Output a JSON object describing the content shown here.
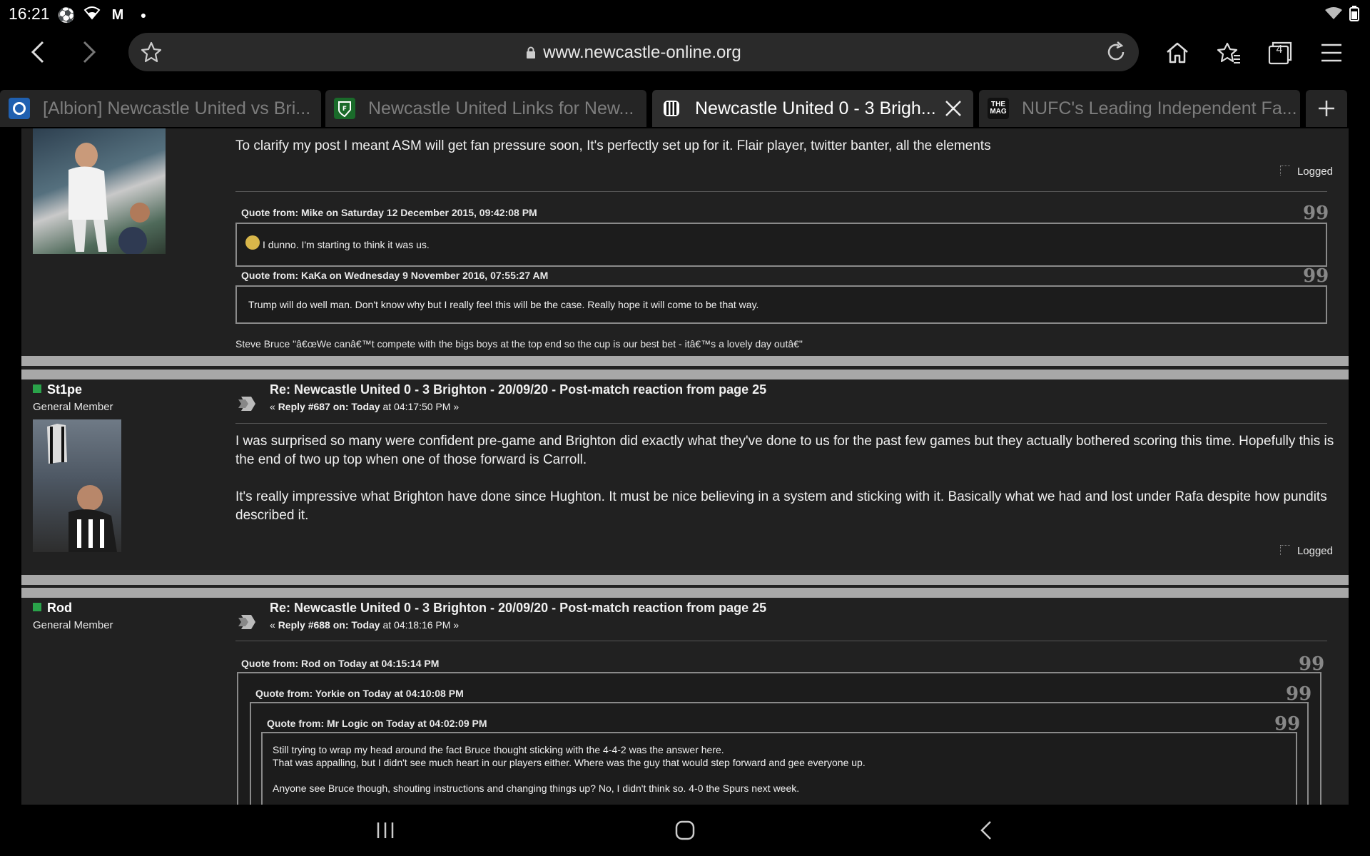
{
  "status": {
    "time": "16:21",
    "left_icons": [
      "football-icon",
      "wifi-icon",
      "gmail-icon",
      "dot-icon"
    ],
    "right_icons": [
      "wifi-signal-icon",
      "battery-icon"
    ]
  },
  "browser": {
    "url": "www.newcastle-online.org",
    "tab_count": "4",
    "tabs": [
      {
        "title": "[Albion] Newcastle United vs Bri...",
        "favicon": "brighton-icon"
      },
      {
        "title": "Newcastle United Links for New...",
        "favicon": "nufc-crest-icon"
      },
      {
        "title": "Newcastle United 0 - 3 Brigh...",
        "favicon": "stripes-icon",
        "active": true
      },
      {
        "title": "NUFC's Leading Independent Fa...",
        "favicon": "the-mag-icon"
      }
    ],
    "the_mag_fav": "THE MAG"
  },
  "posts": {
    "top": {
      "body": "To clarify my post I meant ASM will get fan pressure soon, It's perfectly set up for it. Flair player, twitter banter, all the elements",
      "logged": "Logged",
      "quote1_header": "Quote from: Mike on Saturday 12 December 2015, 09:42:08 PM",
      "quote1_text": "I dunno. I'm starting to think it was us.",
      "quote2_header": "Quote from: KaKa on Wednesday  9 November 2016, 07:55:27 AM",
      "quote2_text": "Trump will do well man. Don't know why but I really feel this will be the case. Really hope it will come to be that way.",
      "signature": "Steve Bruce \"â€œWe canâ€™t compete with the bigs boys at the top end so the cup is our best bet - itâ€™s a lovely day outâ€\""
    },
    "st1pe": {
      "username": "St1pe",
      "rank": "General Member",
      "title": "Re: Newcastle United 0 - 3 Brighton - 20/09/20 - Post-match reaction from page 25",
      "meta_prefix": "« ",
      "meta_reply": "Reply #687 on:",
      "meta_today": " Today",
      "meta_time": " at 04:17:50 PM »",
      "para1": "I was surprised so many were confident pre-game and Brighton did exactly what they've done to us for the past few games but they actually bothered scoring this time. Hopefully this is the end of two up top when one of those forward is Carroll.",
      "para2": "It's really impressive what Brighton have done since Hughton. It must be nice believing in a system and sticking with it. Basically what we had and lost under Rafa despite how pundits described it.",
      "logged": "Logged"
    },
    "rod": {
      "username": "Rod",
      "rank": "General Member",
      "title": "Re: Newcastle United 0 - 3 Brighton - 20/09/20 - Post-match reaction from page 25",
      "meta_prefix": "« ",
      "meta_reply": "Reply #688 on:",
      "meta_today": " Today",
      "meta_time": " at 04:18:16 PM »",
      "q1_header": "Quote from: Rod on Today at 04:15:14 PM",
      "q2_header": "Quote from: Yorkie on Today at 04:10:08 PM",
      "q3_header": "Quote from: Mr Logic on Today at 04:02:09 PM",
      "q3_line1": "Still trying to wrap my head around the fact Bruce thought sticking with the 4-4-2 was the answer here.",
      "q3_line2": "That was appalling, but I didn't see much heart in our players either. Where was the guy that would step forward and gee everyone up.",
      "q3_line3": "Anyone see Bruce though, shouting instructions and changing things up? No, I didn't think so. 4-0 the Spurs next week."
    }
  },
  "colors": {
    "online": "#2aa34a",
    "band": "#a8a8a8",
    "content_bg": "#212121"
  }
}
